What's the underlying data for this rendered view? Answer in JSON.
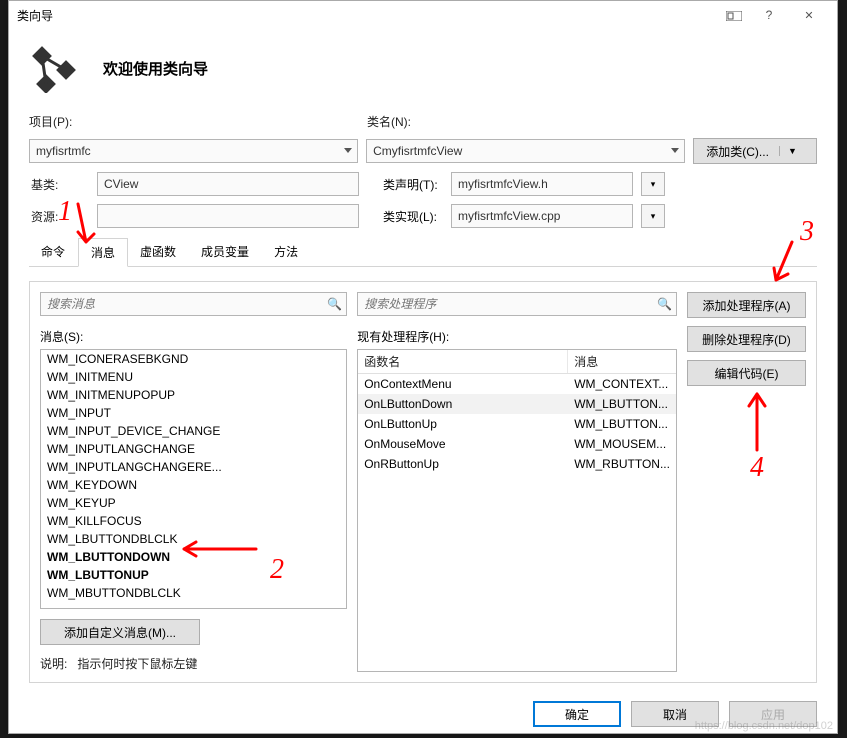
{
  "title": "类向导",
  "header_title": "欢迎使用类向导",
  "labels": {
    "project": "项目(P):",
    "classname": "类名(N):",
    "baseclass": "基类:",
    "resource": "资源:",
    "decl": "类声明(T):",
    "impl": "类实现(L):"
  },
  "project_value": "myfisrtmfc",
  "classname_value": "CmyfisrtmfcView",
  "baseclass_value": "CView",
  "resource_value": "",
  "decl_value": "myfisrtmfcView.h",
  "impl_value": "myfisrtmfcView.cpp",
  "addclass_label": "添加类(C)...",
  "tabs": [
    "命令",
    "消息",
    "虚函数",
    "成员变量",
    "方法"
  ],
  "active_tab": 1,
  "search_msg_ph": "搜索消息",
  "search_hdl_ph": "搜索处理程序",
  "msg_list_label": "消息(S):",
  "hdl_list_label": "现有处理程序(H):",
  "messages": [
    {
      "t": "WM_ICONERASEBKGND",
      "b": false
    },
    {
      "t": "WM_INITMENU",
      "b": false
    },
    {
      "t": "WM_INITMENUPOPUP",
      "b": false
    },
    {
      "t": "WM_INPUT",
      "b": false
    },
    {
      "t": "WM_INPUT_DEVICE_CHANGE",
      "b": false
    },
    {
      "t": "WM_INPUTLANGCHANGE",
      "b": false
    },
    {
      "t": "WM_INPUTLANGCHANGERE...",
      "b": false
    },
    {
      "t": "WM_KEYDOWN",
      "b": false
    },
    {
      "t": "WM_KEYUP",
      "b": false
    },
    {
      "t": "WM_KILLFOCUS",
      "b": false
    },
    {
      "t": "WM_LBUTTONDBLCLK",
      "b": false
    },
    {
      "t": "WM_LBUTTONDOWN",
      "b": true
    },
    {
      "t": "WM_LBUTTONUP",
      "b": true
    },
    {
      "t": "WM_MBUTTONDBLCLK",
      "b": false
    }
  ],
  "hdl_headers": {
    "fn": "函数名",
    "msg": "消息"
  },
  "handlers": [
    {
      "fn": "OnContextMenu",
      "msg": "WM_CONTEXT...",
      "sel": false
    },
    {
      "fn": "OnLButtonDown",
      "msg": "WM_LBUTTON...",
      "sel": true
    },
    {
      "fn": "OnLButtonUp",
      "msg": "WM_LBUTTON...",
      "sel": false
    },
    {
      "fn": "OnMouseMove",
      "msg": "WM_MOUSEM...",
      "sel": false
    },
    {
      "fn": "OnRButtonUp",
      "msg": "WM_RBUTTON...",
      "sel": false
    }
  ],
  "side_buttons": {
    "add": "添加处理程序(A)",
    "del": "删除处理程序(D)",
    "edit": "编辑代码(E)"
  },
  "custom_msg_btn": "添加自定义消息(M)...",
  "desc_label": "说明:",
  "desc_text": "指示何时按下鼠标左键",
  "footer": {
    "ok": "确定",
    "cancel": "取消",
    "apply": "应用"
  },
  "annotations": {
    "n1": "1",
    "n2": "2",
    "n3": "3",
    "n4": "4"
  },
  "watermark": "https://blog.csdn.net/dop102"
}
